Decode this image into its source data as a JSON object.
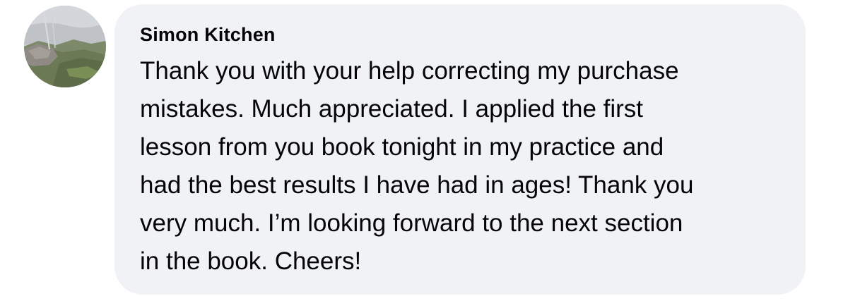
{
  "comment": {
    "author_name": "Simon Kitchen",
    "avatar_icon": "profile-photo-mountain-landscape",
    "message": "Thank you with your help correcting my purchase\nmistakes. Much appreciated. I applied the first\nlesson from you book tonight in my practice and\nhad the best results I have had in ages!  Thank you\nvery much. I’m looking forward to the next section\nin the book. Cheers!",
    "colors": {
      "bubble_background": "#f0f2f5",
      "text": "#050505"
    }
  }
}
